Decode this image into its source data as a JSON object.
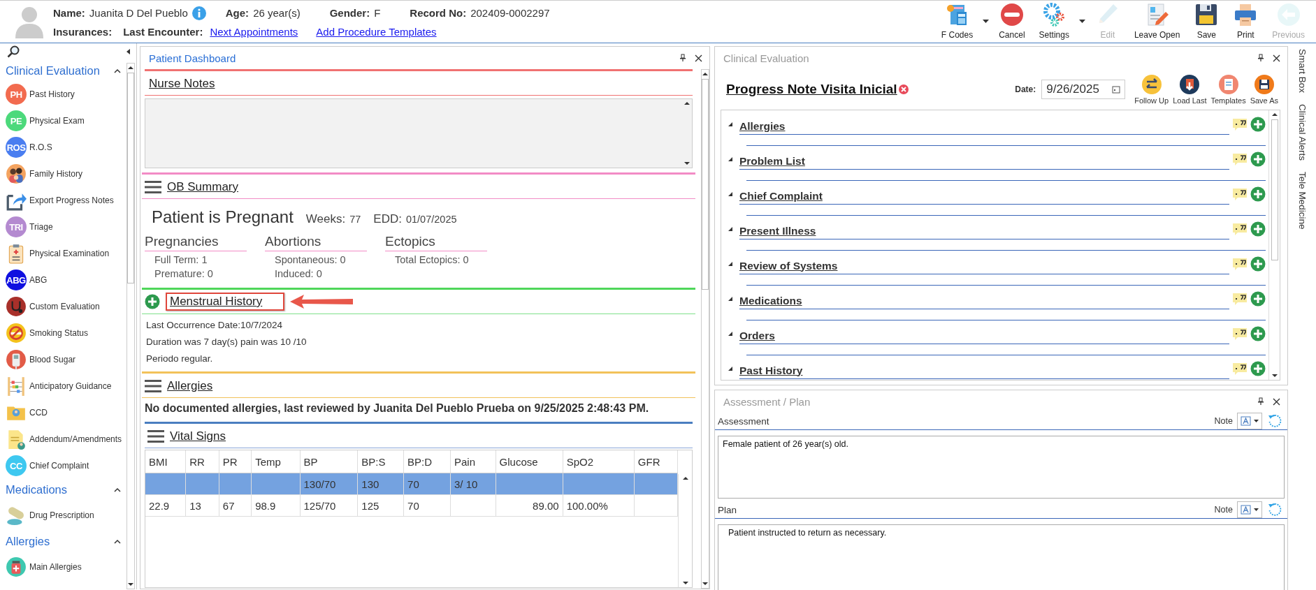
{
  "patient": {
    "name_label": "Name:",
    "name": "Juanita D Del Pueblo",
    "age_label": "Age:",
    "age": "26 year(s)",
    "gender_label": "Gender:",
    "gender": "F",
    "record_label": "Record No:",
    "record": "202409-0002297",
    "insurances_label": "Insurances:",
    "last_encounter_label": "Last Encounter:",
    "links": [
      "Next Appointments",
      "Add Procedure Templates"
    ]
  },
  "toolbar": [
    {
      "label": "F Codes",
      "kind": "fcodes",
      "dropdown": true,
      "disabled": false
    },
    {
      "label": "Cancel",
      "kind": "cancel",
      "dropdown": false,
      "disabled": false
    },
    {
      "label": "Settings",
      "kind": "settings",
      "dropdown": true,
      "disabled": false
    },
    {
      "label": "Edit",
      "kind": "edit",
      "dropdown": false,
      "disabled": true
    },
    {
      "label": "Leave Open",
      "kind": "leave_open",
      "dropdown": false,
      "disabled": false
    },
    {
      "label": "Save",
      "kind": "save",
      "dropdown": false,
      "disabled": false
    },
    {
      "label": "Print",
      "kind": "print",
      "dropdown": false,
      "disabled": false
    },
    {
      "label": "Previous",
      "kind": "previous",
      "dropdown": false,
      "disabled": true
    }
  ],
  "sidebar": {
    "groups": [
      {
        "title": "Clinical Evaluation",
        "expanded": true,
        "items": [
          {
            "label": "Past History",
            "kind": "badge",
            "badge": "PH",
            "color": "#f26b4f"
          },
          {
            "label": "Physical Exam",
            "kind": "badge",
            "badge": "PE",
            "color": "#4cd97b"
          },
          {
            "label": "R.O.S",
            "kind": "badge",
            "badge": "ROS",
            "color": "#4a7ef0"
          },
          {
            "label": "Family History",
            "kind": "family"
          },
          {
            "label": "Export Progress Notes",
            "kind": "export"
          },
          {
            "label": "Triage",
            "kind": "badge",
            "badge": "TRI",
            "color": "#b48ad0"
          },
          {
            "label": "Physical Examination",
            "kind": "clipboard"
          },
          {
            "label": "ABG",
            "kind": "badge",
            "badge": "ABG",
            "color": "#1010e0"
          },
          {
            "label": "Custom Evaluation",
            "kind": "stethoscope"
          },
          {
            "label": "Smoking Status",
            "kind": "smoking"
          },
          {
            "label": "Blood Sugar",
            "kind": "glucometer"
          },
          {
            "label": "Anticipatory Guidance",
            "kind": "abacus"
          },
          {
            "label": "CCD",
            "kind": "folder"
          },
          {
            "label": "Addendum/Amendments",
            "kind": "document"
          },
          {
            "label": "Chief Complaint",
            "kind": "badge",
            "badge": "CC",
            "color": "#3ec8f0"
          }
        ]
      },
      {
        "title": "Medications",
        "expanded": true,
        "items": [
          {
            "label": "Drug Prescription",
            "kind": "pill"
          }
        ]
      },
      {
        "title": "Allergies",
        "expanded": true,
        "items": [
          {
            "label": "Main Allergies",
            "kind": "medkit"
          }
        ]
      }
    ]
  },
  "dashboard": {
    "title": "Patient Dashboard",
    "active": true,
    "nurse_notes": {
      "title": "Nurse Notes"
    },
    "ob_summary": {
      "title": "OB Summary",
      "status": "Patient is Pregnant",
      "weeks_label": "Weeks:",
      "weeks": "77",
      "edd_label": "EDD:",
      "edd": "01/07/2025",
      "columns": [
        {
          "title": "Pregnancies",
          "items": [
            "Full Term: 1",
            "Premature: 0"
          ]
        },
        {
          "title": "Abortions",
          "items": [
            "Spontaneous: 0",
            "Induced: 0"
          ]
        },
        {
          "title": "Ectopics",
          "items": [
            "Total Ectopics: 0"
          ]
        }
      ]
    },
    "menstrual_history": {
      "title": "Menstrual History",
      "highlighted": true,
      "lines": [
        "Last Occurrence Date:10/7/2024",
        "Duration was 7 day(s) pain was 10 /10",
        "Periodo regular."
      ]
    },
    "allergies": {
      "title": "Allergies",
      "text": "No documented allergies, last reviewed by Juanita Del Pueblo Prueba on 9/25/2025 2:48:43 PM."
    },
    "vital_signs": {
      "title": "Vital Signs",
      "columns": [
        {
          "label": "BMI"
        },
        {
          "label": "RR"
        },
        {
          "label": "PR"
        },
        {
          "label": "Temp"
        },
        {
          "label": "BP"
        },
        {
          "label": "BP:S"
        },
        {
          "label": "BP:D"
        },
        {
          "label": "Pain"
        },
        {
          "label": "Glucose"
        },
        {
          "label": "SpO2"
        },
        {
          "label": "GFR"
        }
      ],
      "rows": [
        {
          "selected": true,
          "cells": [
            null,
            null,
            null,
            null,
            "130/70",
            "130",
            "70",
            "3/ 10",
            null,
            null,
            null
          ]
        },
        {
          "selected": false,
          "cells": [
            "22.9",
            "13",
            "67",
            "98.9",
            "125/70",
            "125",
            "70",
            null,
            "89.00",
            "100.00%",
            null
          ]
        }
      ]
    }
  },
  "clinical_evaluation": {
    "title": "Clinical Evaluation",
    "active": false,
    "note_title": "Progress Note Visita Inicial",
    "date_label": "Date:",
    "date": "9/26/2025",
    "actions": [
      {
        "label": "Follow Up",
        "kind": "follow"
      },
      {
        "label": "Load Last",
        "kind": "load"
      },
      {
        "label": "Templates",
        "kind": "templates"
      },
      {
        "label": "Save As",
        "kind": "saveas"
      }
    ],
    "sections": [
      "Allergies",
      "Problem List",
      "Chief Complaint",
      "Present Illness",
      "Review of Systems",
      "Medications",
      "Orders",
      "Past History"
    ]
  },
  "assessment_plan": {
    "title": "Assessment / Plan",
    "active": false,
    "notes": [
      {
        "label": "Assessment",
        "note_label": "Note",
        "text": "Female patient of 26 year(s) old."
      },
      {
        "label": "Plan",
        "note_label": "Note",
        "text": "Patient instructed to return as necessary."
      }
    ]
  },
  "side_tabs": [
    "Smart Box",
    "Clinical Alerts",
    "Tele Medicine"
  ]
}
